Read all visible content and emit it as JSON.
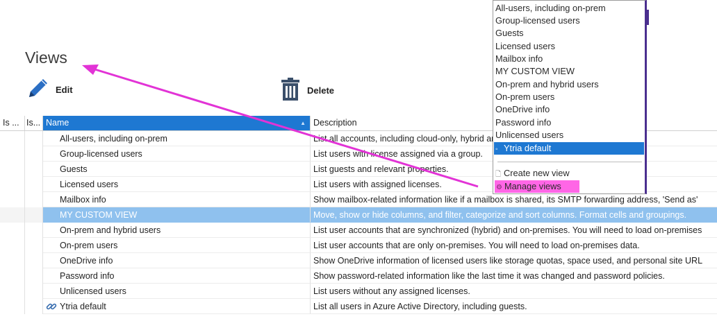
{
  "page": {
    "title": "Views"
  },
  "toolbar": {
    "edit_label": "Edit",
    "delete_label": "Delete"
  },
  "grid": {
    "columns": [
      "Is ...",
      "Is...",
      "Name",
      "Description"
    ],
    "sorted_column": "Name",
    "rows": [
      {
        "name": "All-users, including on-prem",
        "description": "List all accounts, including cloud-only, hybrid and on-premises da"
      },
      {
        "name": "Group-licensed users",
        "description": "List users with license assigned via a group."
      },
      {
        "name": "Guests",
        "description": "List guests and relevant properties."
      },
      {
        "name": "Licensed users",
        "description": "List users with assigned licenses."
      },
      {
        "name": "Mailbox info",
        "description": "Show mailbox-related information like if a mailbox is shared, its SMTP forwarding address, 'Send as'"
      },
      {
        "name": "MY CUSTOM VIEW",
        "description": "Move, show or hide columns, and filter, categorize and sort columns. Format cells and groupings.",
        "selected": true
      },
      {
        "name": "On-prem and hybrid users",
        "description": "List user accounts that are synchronized (hybrid) and on-premises. You will need to load on-premises"
      },
      {
        "name": "On-prem users",
        "description": "List user accounts that are only on-premises. You will need to load on-premises data."
      },
      {
        "name": "OneDrive info",
        "description": "Show OneDrive information of licensed users like storage quotas, space used, and personal site URL"
      },
      {
        "name": "Password info",
        "description": "Show password-related information like the last time it was changed and password policies."
      },
      {
        "name": "Unlicensed users",
        "description": "List users without any assigned licenses."
      },
      {
        "name": "Ytria default",
        "description": "List all users in Azure Active Directory, including guests.",
        "icon": "link-icon"
      }
    ]
  },
  "menu": {
    "items": [
      "All-users, including on-prem",
      "Group-licensed users",
      "Guests",
      "Licensed users",
      "Mailbox info",
      "MY CUSTOM VIEW",
      "On-prem and hybrid users",
      "On-prem users",
      "OneDrive info",
      "Password info",
      "Unlicensed users"
    ],
    "active_item": "Ytria default",
    "create_label": "Create new view",
    "manage_label": "Manage views"
  },
  "colors": {
    "accent": "#1e78d2",
    "selected_row": "#8fc1ee",
    "highlight": "#ff66e6",
    "arrow": "#e233d6"
  }
}
